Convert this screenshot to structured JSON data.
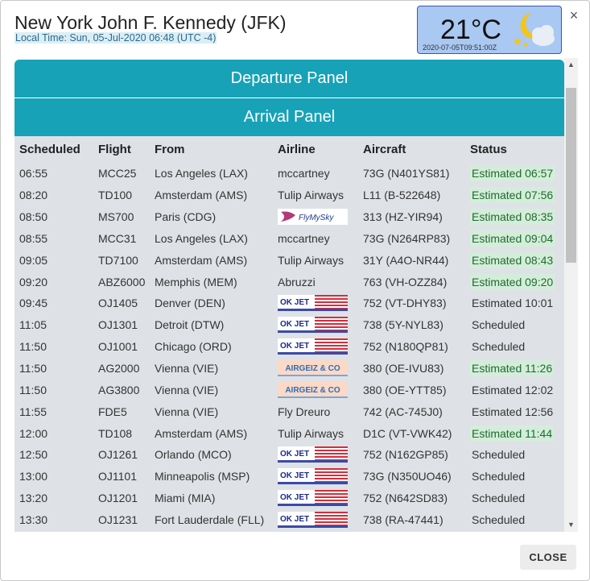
{
  "header": {
    "title": "New York John F. Kennedy (JFK)",
    "local_time": "Local Time: Sun, 05-Jul-2020 06:48 (UTC -4)"
  },
  "weather": {
    "temperature": "21°C",
    "timestamp": "2020-07-05T09:51:00Z",
    "icon": "moon-cloud-icon"
  },
  "panels": {
    "departure": "Departure Panel",
    "arrival": "Arrival Panel"
  },
  "table": {
    "headers": [
      "Scheduled",
      "Flight",
      "From",
      "Airline",
      "Aircraft",
      "Status"
    ],
    "rows": [
      {
        "scheduled": "06:55",
        "flight": "MCC25",
        "from": "Los Angeles (LAX)",
        "airline": "mccartney",
        "airline_logo": "",
        "aircraft": "73G  (N401YS81)",
        "status": "Estimated 06:57",
        "highlight": true
      },
      {
        "scheduled": "08:20",
        "flight": "TD100",
        "from": "Amsterdam (AMS)",
        "airline": "Tulip Airways",
        "airline_logo": "",
        "aircraft": "L11  (B-522648)",
        "status": "Estimated 07:56",
        "highlight": true
      },
      {
        "scheduled": "08:50",
        "flight": "MS700",
        "from": "Paris (CDG)",
        "airline": "",
        "airline_logo": "FlyMySky",
        "aircraft": "313  (HZ-YIR94)",
        "status": "Estimated 08:35",
        "highlight": true
      },
      {
        "scheduled": "08:55",
        "flight": "MCC31",
        "from": "Los Angeles (LAX)",
        "airline": "mccartney",
        "airline_logo": "",
        "aircraft": "73G  (N264RP83)",
        "status": "Estimated 09:04",
        "highlight": true
      },
      {
        "scheduled": "09:05",
        "flight": "TD7100",
        "from": "Amsterdam (AMS)",
        "airline": "Tulip Airways",
        "airline_logo": "",
        "aircraft": "31Y  (A4O-NR44)",
        "status": "Estimated 08:43",
        "highlight": true
      },
      {
        "scheduled": "09:20",
        "flight": "ABZ6000",
        "from": "Memphis (MEM)",
        "airline": "Abruzzi",
        "airline_logo": "",
        "aircraft": "763  (VH-OZZ84)",
        "status": "Estimated 09:20",
        "highlight": true
      },
      {
        "scheduled": "09:45",
        "flight": "OJ1405",
        "from": "Denver (DEN)",
        "airline": "",
        "airline_logo": "OK JET",
        "aircraft": "752  (VT-DHY83)",
        "status": "Estimated 10:01",
        "highlight": false
      },
      {
        "scheduled": "11:05",
        "flight": "OJ1301",
        "from": "Detroit (DTW)",
        "airline": "",
        "airline_logo": "OK JET",
        "aircraft": "738  (5Y-NYL83)",
        "status": "Scheduled",
        "highlight": false
      },
      {
        "scheduled": "11:50",
        "flight": "OJ1001",
        "from": "Chicago (ORD)",
        "airline": "",
        "airline_logo": "OK JET",
        "aircraft": "752  (N180QP81)",
        "status": "Scheduled",
        "highlight": false
      },
      {
        "scheduled": "11:50",
        "flight": "AG2000",
        "from": "Vienna (VIE)",
        "airline": "",
        "airline_logo": "AIRGEIZ & CO",
        "aircraft": "380  (OE-IVU83)",
        "status": "Estimated 11:26",
        "highlight": true
      },
      {
        "scheduled": "11:50",
        "flight": "AG3800",
        "from": "Vienna (VIE)",
        "airline": "",
        "airline_logo": "AIRGEIZ & CO",
        "aircraft": "380  (OE-YTT85)",
        "status": "Estimated 12:02",
        "highlight": false
      },
      {
        "scheduled": "11:55",
        "flight": "FDE5",
        "from": "Vienna (VIE)",
        "airline": "Fly Dreuro",
        "airline_logo": "",
        "aircraft": "742  (AC-745J0)",
        "status": "Estimated 12:56",
        "highlight": false
      },
      {
        "scheduled": "12:00",
        "flight": "TD108",
        "from": "Amsterdam (AMS)",
        "airline": "Tulip Airways",
        "airline_logo": "",
        "aircraft": "D1C  (VT-VWK42)",
        "status": "Estimated 11:44",
        "highlight": true
      },
      {
        "scheduled": "12:50",
        "flight": "OJ1261",
        "from": "Orlando (MCO)",
        "airline": "",
        "airline_logo": "OK JET",
        "aircraft": "752  (N162GP85)",
        "status": "Scheduled",
        "highlight": false
      },
      {
        "scheduled": "13:00",
        "flight": "OJ1101",
        "from": "Minneapolis (MSP)",
        "airline": "",
        "airline_logo": "OK JET",
        "aircraft": "73G  (N350UO46)",
        "status": "Scheduled",
        "highlight": false
      },
      {
        "scheduled": "13:20",
        "flight": "OJ1201",
        "from": "Miami (MIA)",
        "airline": "",
        "airline_logo": "OK JET",
        "aircraft": "752  (N642SD83)",
        "status": "Scheduled",
        "highlight": false
      },
      {
        "scheduled": "13:30",
        "flight": "OJ1231",
        "from": "Fort Lauderdale (FLL)",
        "airline": "",
        "airline_logo": "OK JET",
        "aircraft": "738  (RA-47441)",
        "status": "Scheduled",
        "highlight": false
      }
    ]
  },
  "buttons": {
    "close": "CLOSE",
    "close_x": "×"
  },
  "colors": {
    "panel": "#17a2b8",
    "table_bg": "#dee2e6",
    "status_highlight": "#d4edda",
    "weather_bg": "#a9c8f2"
  }
}
